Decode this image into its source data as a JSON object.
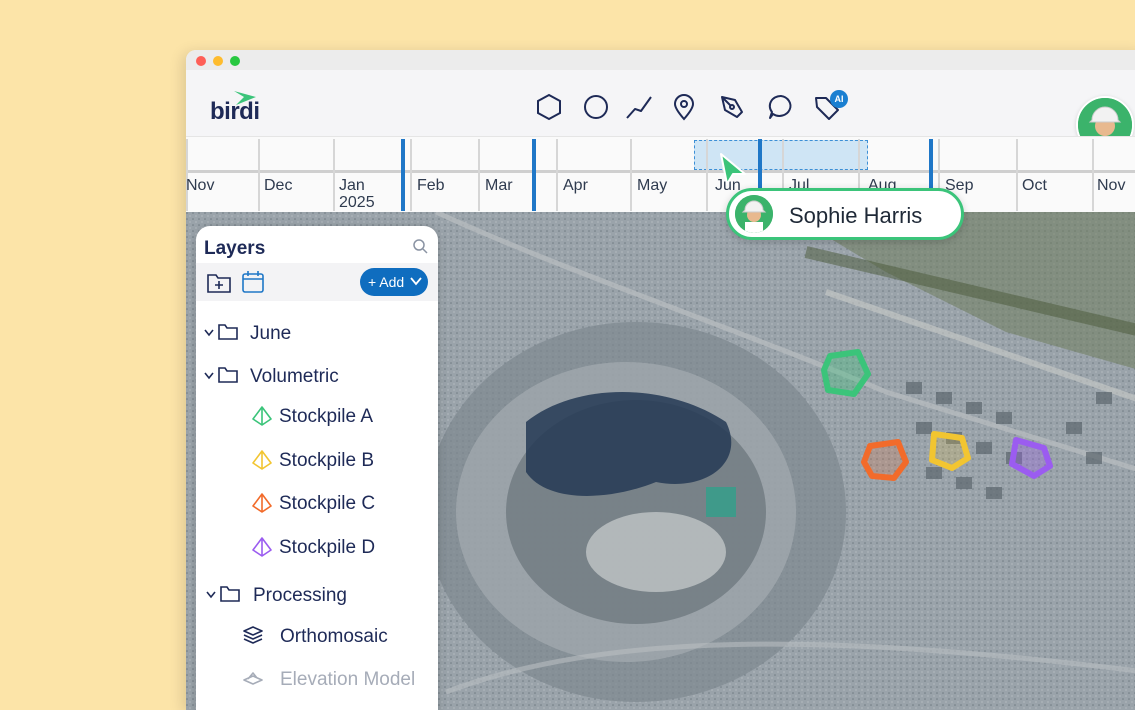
{
  "app": {
    "logo_text": "birdi"
  },
  "toolbar": {
    "tools": [
      {
        "icon": "polygon-icon"
      },
      {
        "icon": "circle-icon"
      },
      {
        "icon": "line-icon"
      },
      {
        "icon": "location-pin-icon"
      },
      {
        "icon": "pen-icon"
      },
      {
        "icon": "comment-icon"
      },
      {
        "icon": "ai-tag-icon",
        "badge": "AI"
      }
    ]
  },
  "timeline": {
    "months": [
      "Nov",
      "Dec",
      "Jan\n2025",
      "Feb",
      "Mar",
      "Apr",
      "May",
      "Jun",
      "Jul",
      "Aug",
      "Sep",
      "Oct",
      "Nov"
    ]
  },
  "collaborator": {
    "name": "Sophie Harris",
    "accent": "#3bc47a"
  },
  "layers": {
    "title": "Layers",
    "add_label": "+ Add",
    "items": [
      {
        "type": "folder",
        "label": "June"
      },
      {
        "type": "folder",
        "label": "Volumetric"
      },
      {
        "type": "stockpile",
        "label": "Stockpile A",
        "color": "#3bc47a"
      },
      {
        "type": "stockpile",
        "label": "Stockpile B",
        "color": "#f2c531"
      },
      {
        "type": "stockpile",
        "label": "Stockpile C",
        "color": "#f26b2a"
      },
      {
        "type": "stockpile",
        "label": "Stockpile D",
        "color": "#9b5cf0"
      },
      {
        "type": "folder",
        "label": "Processing"
      },
      {
        "type": "layer",
        "label": "Orthomosaic"
      },
      {
        "type": "layer",
        "label": "Elevation Model",
        "disabled": true
      }
    ]
  },
  "colors": {
    "brand_navy": "#1e2a57",
    "brand_green": "#3bc47a",
    "primary_blue": "#0f6dbf"
  }
}
